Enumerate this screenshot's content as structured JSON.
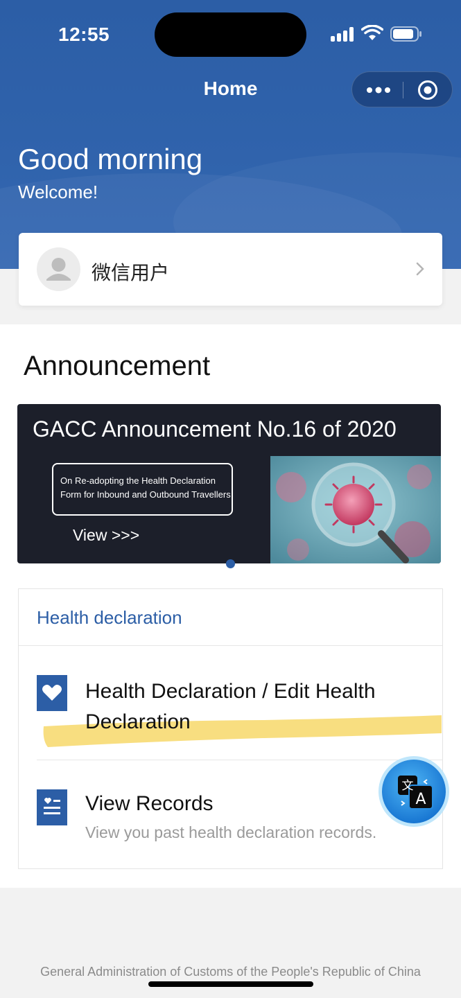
{
  "status_bar": {
    "time": "12:55"
  },
  "nav": {
    "title": "Home"
  },
  "hero": {
    "greeting": "Good morning",
    "welcome": "Welcome!"
  },
  "user": {
    "name": "微信用户"
  },
  "announcement": {
    "section_title": "Announcement",
    "banner": {
      "title": "GACC Announcement No.16 of 2020",
      "box_line_1": "On Re-adopting the Health Declaration",
      "box_line_2": "Form for Inbound and Outbound Travellers",
      "view_label": "View >>>"
    }
  },
  "health": {
    "section_title": "Health declaration",
    "items": [
      {
        "title": "Health Declaration / Edit Health Declaration",
        "icon": "heart-icon"
      },
      {
        "title": "View Records",
        "subtitle": "View you past health declaration records.",
        "icon": "records-icon"
      }
    ]
  },
  "footer": {
    "text": "General Administration of Customs of the People's Republic of China"
  },
  "colors": {
    "brand_blue": "#2c5ea6",
    "highlight_yellow": "#f7d86a"
  }
}
